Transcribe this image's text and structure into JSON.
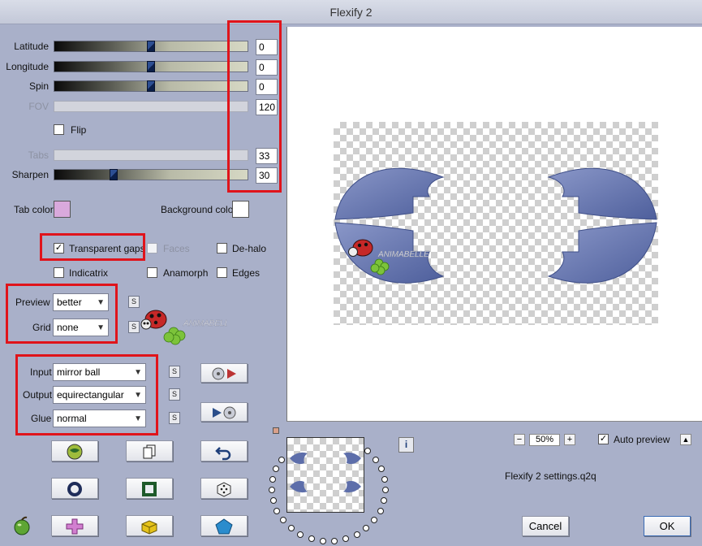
{
  "window": {
    "title": "Flexify 2"
  },
  "params": [
    {
      "key": "latitude",
      "label": "Latitude",
      "value": "0",
      "enabled": true
    },
    {
      "key": "longitude",
      "label": "Longitude",
      "value": "0",
      "enabled": true
    },
    {
      "key": "spin",
      "label": "Spin",
      "value": "0",
      "enabled": true
    },
    {
      "key": "fov",
      "label": "FOV",
      "value": "120",
      "enabled": false
    },
    {
      "key": "tabs",
      "label": "Tabs",
      "value": "33",
      "enabled": false
    },
    {
      "key": "sharpen",
      "label": "Sharpen",
      "value": "30",
      "enabled": true
    }
  ],
  "slider_levels": {
    "latitude": 0.5,
    "longitude": 0.5,
    "spin": 0.5,
    "sharpen": 0.3
  },
  "flip": {
    "label": "Flip",
    "checked": false
  },
  "colors": {
    "tab_color_label": "Tab color",
    "tab_color": "#d9a9dc",
    "background_color_label": "Background color",
    "background_color": "#ffffff",
    "highlight": "#e0141b",
    "dialog_bg": "#a9b0c9",
    "shape_fill": "#5d6eaa"
  },
  "options": {
    "transparent_gaps": {
      "label": "Transparent gaps",
      "checked": true
    },
    "faces": {
      "label": "Faces",
      "checked": false,
      "enabled": false
    },
    "dehalo": {
      "label": "De-halo",
      "checked": false
    },
    "indicatrix": {
      "label": "Indicatrix",
      "checked": false
    },
    "anamorph": {
      "label": "Anamorph",
      "checked": false
    },
    "edges": {
      "label": "Edges",
      "checked": false
    }
  },
  "preview_quality": {
    "label": "Preview",
    "value": "better"
  },
  "grid": {
    "label": "Grid",
    "value": "none"
  },
  "projection": {
    "input_label": "Input",
    "input": "mirror ball",
    "output_label": "Output",
    "output": "equirectangular",
    "glue_label": "Glue",
    "glue": "normal"
  },
  "s_button_label": "S",
  "watermark": "ANIMABELLE",
  "zoom": {
    "minus": "−",
    "value": "50%",
    "plus": "+"
  },
  "auto_preview": {
    "label": "Auto preview",
    "checked": true
  },
  "settings_file": "Flexify 2 settings.q2q",
  "info_icon": "i",
  "buttons": {
    "cancel": "Cancel",
    "ok": "OK"
  },
  "icons": {
    "random": "dice-icon",
    "undo": "undo-icon",
    "copy": "copy-pages-icon",
    "ring": "ring-icon",
    "square": "square-frame-icon",
    "plus_shape": "plus-shape-icon",
    "cube": "yellow-cube-icon",
    "pentagon": "pentagon-icon",
    "apple": "apple-icon",
    "globe": "globe-icon",
    "disc_to_play": "disc-to-play-icon",
    "play_to_disc": "play-to-disc-icon"
  }
}
